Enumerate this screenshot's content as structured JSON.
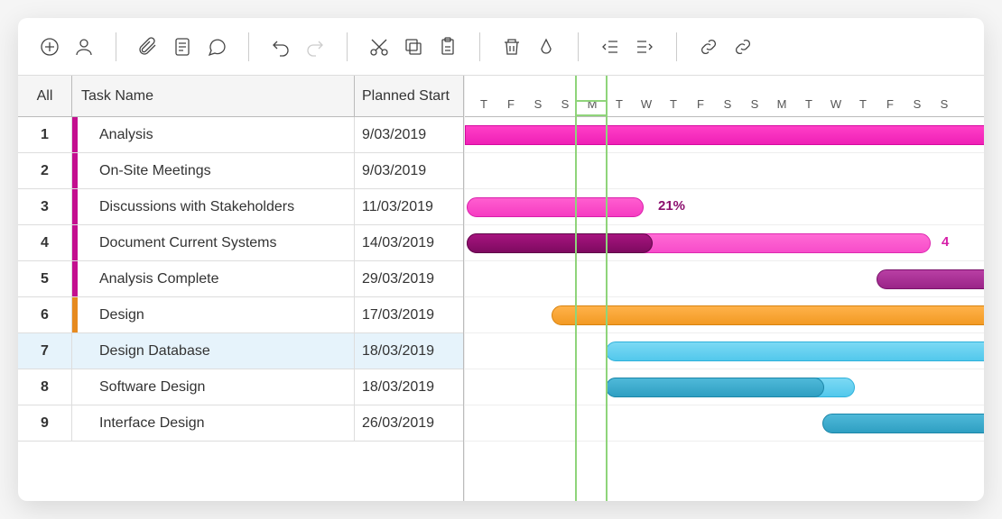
{
  "toolbar": {
    "icons": [
      "add",
      "person",
      "attach",
      "notes",
      "comment",
      "undo",
      "redo",
      "cut",
      "copy",
      "paste",
      "delete",
      "fill",
      "outdent",
      "indent",
      "link",
      "unlink"
    ]
  },
  "columns": {
    "all": "All",
    "name": "Task Name",
    "start": "Planned Start"
  },
  "tasks": [
    {
      "num": "1",
      "name": "Analysis",
      "start": "9/03/2019",
      "color": "#c40f8f"
    },
    {
      "num": "2",
      "name": "On-Site Meetings",
      "start": "9/03/2019",
      "color": "#c40f8f"
    },
    {
      "num": "3",
      "name": "Discussions with Stakeholders",
      "start": "11/03/2019",
      "color": "#c40f8f"
    },
    {
      "num": "4",
      "name": "Document Current Systems",
      "start": "14/03/2019",
      "color": "#c40f8f"
    },
    {
      "num": "5",
      "name": "Analysis Complete",
      "start": "29/03/2019",
      "color": "#c40f8f"
    },
    {
      "num": "6",
      "name": "Design",
      "start": "17/03/2019",
      "color": "#e68a1f"
    },
    {
      "num": "7",
      "name": "Design Database",
      "start": "18/03/2019",
      "color": "",
      "selected": true
    },
    {
      "num": "8",
      "name": "Software Design",
      "start": "18/03/2019",
      "color": ""
    },
    {
      "num": "9",
      "name": "Interface Design",
      "start": "26/03/2019",
      "color": ""
    }
  ],
  "days": [
    "T",
    "F",
    "S",
    "S",
    "M",
    "T",
    "W",
    "T",
    "F",
    "S",
    "S",
    "M",
    "T",
    "W",
    "T",
    "F",
    "S",
    "S"
  ],
  "today_index": 4,
  "chart_data": {
    "type": "bar",
    "title": "",
    "xlabel": "",
    "ylabel": "",
    "categories": [
      "Analysis",
      "On-Site Meetings",
      "Discussions with Stakeholders",
      "Document Current Systems",
      "Analysis Complete",
      "Design",
      "Design Database",
      "Software Design",
      "Interface Design"
    ],
    "series": [
      {
        "name": "bar_start_day_index",
        "values": [
          0,
          null,
          0,
          0,
          15,
          3,
          5,
          5,
          13
        ]
      },
      {
        "name": "bar_end_day_index",
        "values": [
          18,
          null,
          6,
          17,
          18,
          18,
          18,
          14,
          18
        ]
      },
      {
        "name": "progress_pct",
        "values": [
          null,
          null,
          21,
          40,
          null,
          null,
          null,
          null,
          null
        ]
      }
    ],
    "annotations": [
      {
        "row": 2,
        "text": "21%",
        "color": "#8c0f6e"
      },
      {
        "row": 3,
        "text": "4",
        "color": "#d61fa8"
      }
    ],
    "colors": {
      "Analysis": "#ef20b6",
      "Discussions with Stakeholders": "#f63cc2",
      "Document Current Systems_progress": "#7e0a60",
      "Document Current Systems_remain": "#f74cca",
      "Analysis Complete": "#9a2488",
      "Design": "#f29a24",
      "Design Database": "#52c8ec",
      "Software Design_progress": "#2f9fc2",
      "Software Design_remain": "#52c8ec",
      "Interface Design": "#2f9fc2"
    }
  },
  "pct_labels": {
    "r3": "21%",
    "r4": "4"
  }
}
